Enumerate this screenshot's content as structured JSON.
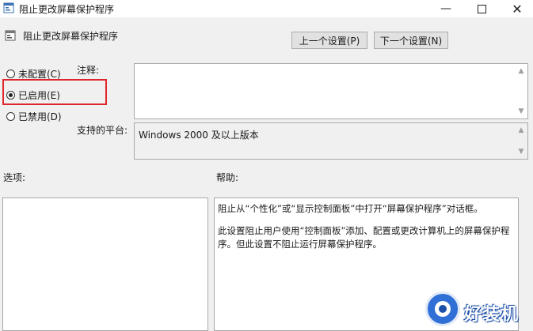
{
  "window": {
    "title": "阻止更改屏幕保护程序",
    "minimize_glyph": "—",
    "close_glyph": "✕"
  },
  "header": {
    "setting_name": "阻止更改屏幕保护程序",
    "prev_button": "上一个设置(P)",
    "next_button": "下一个设置(N)"
  },
  "state_options": [
    {
      "label": "未配置(C)",
      "checked": false
    },
    {
      "label": "已启用(E)",
      "checked": true
    },
    {
      "label": "已禁用(D)",
      "checked": false
    }
  ],
  "labels": {
    "comment": "注释:",
    "platform": "支持的平台:",
    "options": "选项:",
    "help": "帮助:"
  },
  "platform_value": "Windows 2000 及以上版本",
  "help_paragraphs": [
    "阻止从“个性化”或“显示控制面板”中打开“屏幕保护程序”对话框。",
    "此设置阻止用户使用“控制面板”添加、配置或更改计算机上的屏幕保护程序。但此设置不阻止运行屏幕保护程序。"
  ],
  "watermark": {
    "text": "好装机"
  },
  "colors": {
    "highlight_box": "#e0262a",
    "watermark_blue": "#2f6fd6"
  }
}
